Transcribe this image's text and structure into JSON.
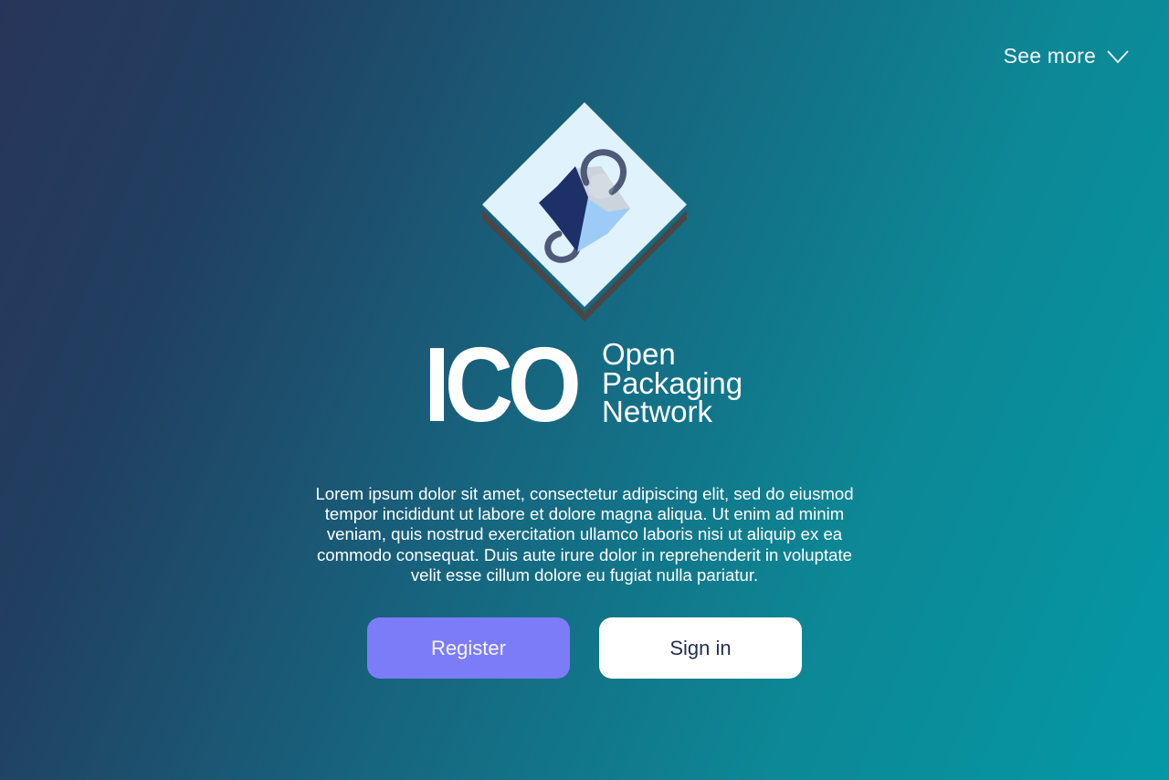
{
  "header": {
    "see_more_label": "See more"
  },
  "logo": {
    "icon_name": "package-cube-link-icon",
    "colors": {
      "tile": "#e0f2fb",
      "tile_shadow": "#474747",
      "cube_dark": "#1d3068",
      "cube_light": "#9ccbf7",
      "cube_top": "#cbd3dd",
      "link": "#4e5a78"
    }
  },
  "brand": {
    "name": "ICO",
    "tagline_lines": [
      "Open",
      "Packaging",
      "Network"
    ]
  },
  "description": "Lorem ipsum dolor sit amet, consectetur adipiscing elit, sed do eiusmod tempor incididunt ut labore et dolore magna aliqua. Ut enim ad minim veniam, quis nostrud exercitation ullamco laboris nisi ut aliquip ex ea commodo consequat. Duis aute irure dolor in reprehenderit in voluptate velit esse cillum dolore eu fugiat nulla pariatur.",
  "actions": {
    "register_label": "Register",
    "signin_label": "Sign in"
  },
  "colors": {
    "background_start": "#28355a",
    "background_end": "#0499a6",
    "register_button": "#7d7cf8",
    "signin_button": "#ffffff",
    "signin_text": "#23304d"
  }
}
